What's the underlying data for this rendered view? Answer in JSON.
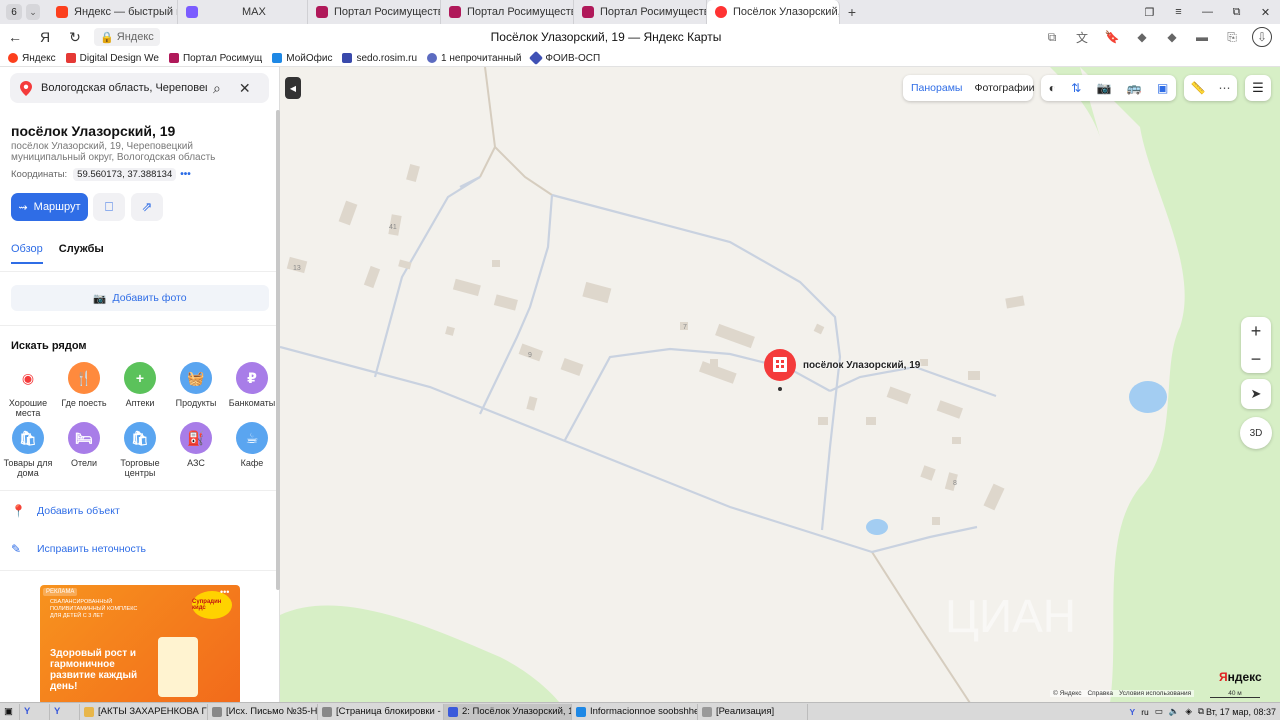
{
  "browser": {
    "tab_count": "6",
    "tabs": [
      {
        "label": "Яндекс — быстрый поиск",
        "color": "#fc3f1d"
      },
      {
        "label": "MAX",
        "color": "#7b5cff"
      },
      {
        "label": "Портал Росимущества",
        "color": "#b0195a"
      },
      {
        "label": "Портал Росимущества",
        "color": "#b0195a"
      },
      {
        "label": "Портал Росимущества",
        "color": "#b0195a"
      },
      {
        "label": "Посёлок Улазорский, 1",
        "color": "#ff3333"
      }
    ],
    "window_title": "Посёлок Улазорский, 19 — Яндекс Карты",
    "address_chip": "Яндекс",
    "bookmarks": [
      {
        "label": "Яндекс",
        "color": "#fc3f1d"
      },
      {
        "label": "Digital Design We",
        "color": "#e53935"
      },
      {
        "label": "Портал Росимущ",
        "color": "#b0195a"
      },
      {
        "label": "МойОфис",
        "color": "#1e88e5"
      },
      {
        "label": "sedo.rosim.ru",
        "color": "#3949ab"
      },
      {
        "label": "1 непрочитанный",
        "color": "#5c6bc0"
      },
      {
        "label": "ФОИВ-ОСП",
        "color": "#3f51b5"
      }
    ]
  },
  "sidebar": {
    "search_value": "Вологодская область, Череповецкий",
    "place_title": "посёлок Улазорский, 19",
    "place_address": "посёлок Улазорский, 19, Череповецкий муниципальный округ, Вологодская область",
    "coords_label": "Координаты:",
    "coords_value": "59.560173, 37.388134",
    "route_label": "Маршрут",
    "tabs": [
      "Обзор",
      "Службы"
    ],
    "add_photo": "Добавить фото",
    "nearby_title": "Искать рядом",
    "categories": [
      {
        "label": "Хорошие места",
        "color": "#ffffff",
        "icon": "◎"
      },
      {
        "label": "Где поесть",
        "color": "#ff8a3d",
        "icon": "🍴"
      },
      {
        "label": "Аптеки",
        "color": "#5bc25b",
        "icon": "+"
      },
      {
        "label": "Продукты",
        "color": "#5aa5f0",
        "icon": "🛒"
      },
      {
        "label": "Банкоматы",
        "color": "#a87de8",
        "icon": "₽"
      },
      {
        "label": "Товары для дома",
        "color": "#5aa5f0",
        "icon": "🛍"
      },
      {
        "label": "Отели",
        "color": "#a87de8",
        "icon": "🛏"
      },
      {
        "label": "Торговые центры",
        "color": "#5aa5f0",
        "icon": "🛍"
      },
      {
        "label": "АЗС",
        "color": "#a87de8",
        "icon": "⛽"
      },
      {
        "label": "Кафе",
        "color": "#5aa5f0",
        "icon": "☕"
      }
    ],
    "add_object": "Добавить объект",
    "fix_error": "Исправить неточность",
    "ad": {
      "label": "РЕКЛАМА",
      "fine": "СБАЛАНСИРОВАННЫЙ ПОЛИВИТАМИННЫЙ КОМПЛЕКС ДЛЯ ДЕТЕЙ С 3 ЛЕТ",
      "headline": "Здоровый рост и гармоничное развитие каждый день!",
      "brand": "Супрадин кидс"
    }
  },
  "map": {
    "layer_panoramas": "Панорамы",
    "layer_photos": "Фотографии",
    "marker_label": "посёлок Улазорский, 19",
    "house_numbers": [
      "41",
      "13",
      "7",
      "9",
      "8"
    ],
    "zoom_in": "+",
    "zoom_out": "−",
    "btn_3d": "3D",
    "footer_links": [
      "© Яндекс",
      "Справка",
      "Условия использования"
    ],
    "scale": "40 м",
    "logo": "Яндекс"
  },
  "taskbar": {
    "items": [
      {
        "label": "[АКТЫ ЗАХАРЕНКОВА ГРА...",
        "color": "#e8b64a"
      },
      {
        "label": "[Исх. Письмо №35-НМ-0...",
        "color": "#888888"
      },
      {
        "label": "[Страница блокировки - ...",
        "color": "#888888"
      },
      {
        "label": "2: Посёлок Улазорский, 1...",
        "color": "#3b5bdb"
      },
      {
        "label": "Informacionnoe soobshhe...",
        "color": "#1e88e5"
      },
      {
        "label": "[Реализация]",
        "color": "#999999"
      }
    ],
    "lang": "ru",
    "clock": "Вт, 17 мар, 08:37"
  }
}
